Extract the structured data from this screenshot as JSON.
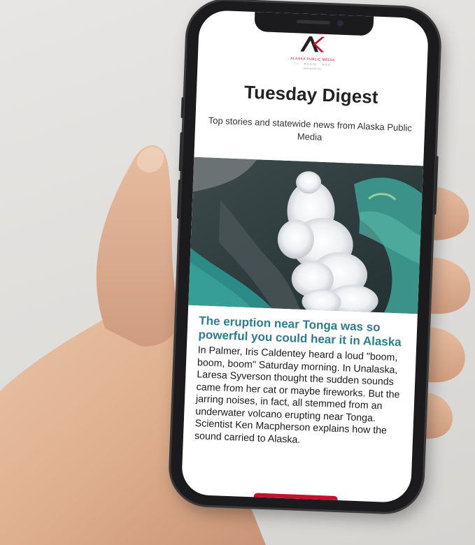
{
  "logo": {
    "mark": "AK",
    "name": "ALASKA PUBLIC MEDIA",
    "sub": "TV · RADIO · WEB",
    "url": "alaskapublic.org"
  },
  "email": {
    "title": "Tuesday Digest",
    "tagline": "Top stories and statewide news from Alaska Public Media"
  },
  "story": {
    "image": "satellite-eruption-photo",
    "headline": "The eruption near Tonga was so powerful you could hear it in Alaska",
    "body": "In Palmer, Iris Caldentey heard a loud \"boom, boom, boom\" Saturday morning. In Unalaska, Laresa Syverson thought the sudden sounds came from her cat or maybe fireworks. But the jarring noises, in fact, all stemmed from an underwater volcano erupting near Tonga. Scientist Ken Macpherson explains how the sound carried to Alaska."
  },
  "colors": {
    "brand_red": "#c8102e",
    "headline_teal": "#2e7d8f"
  }
}
